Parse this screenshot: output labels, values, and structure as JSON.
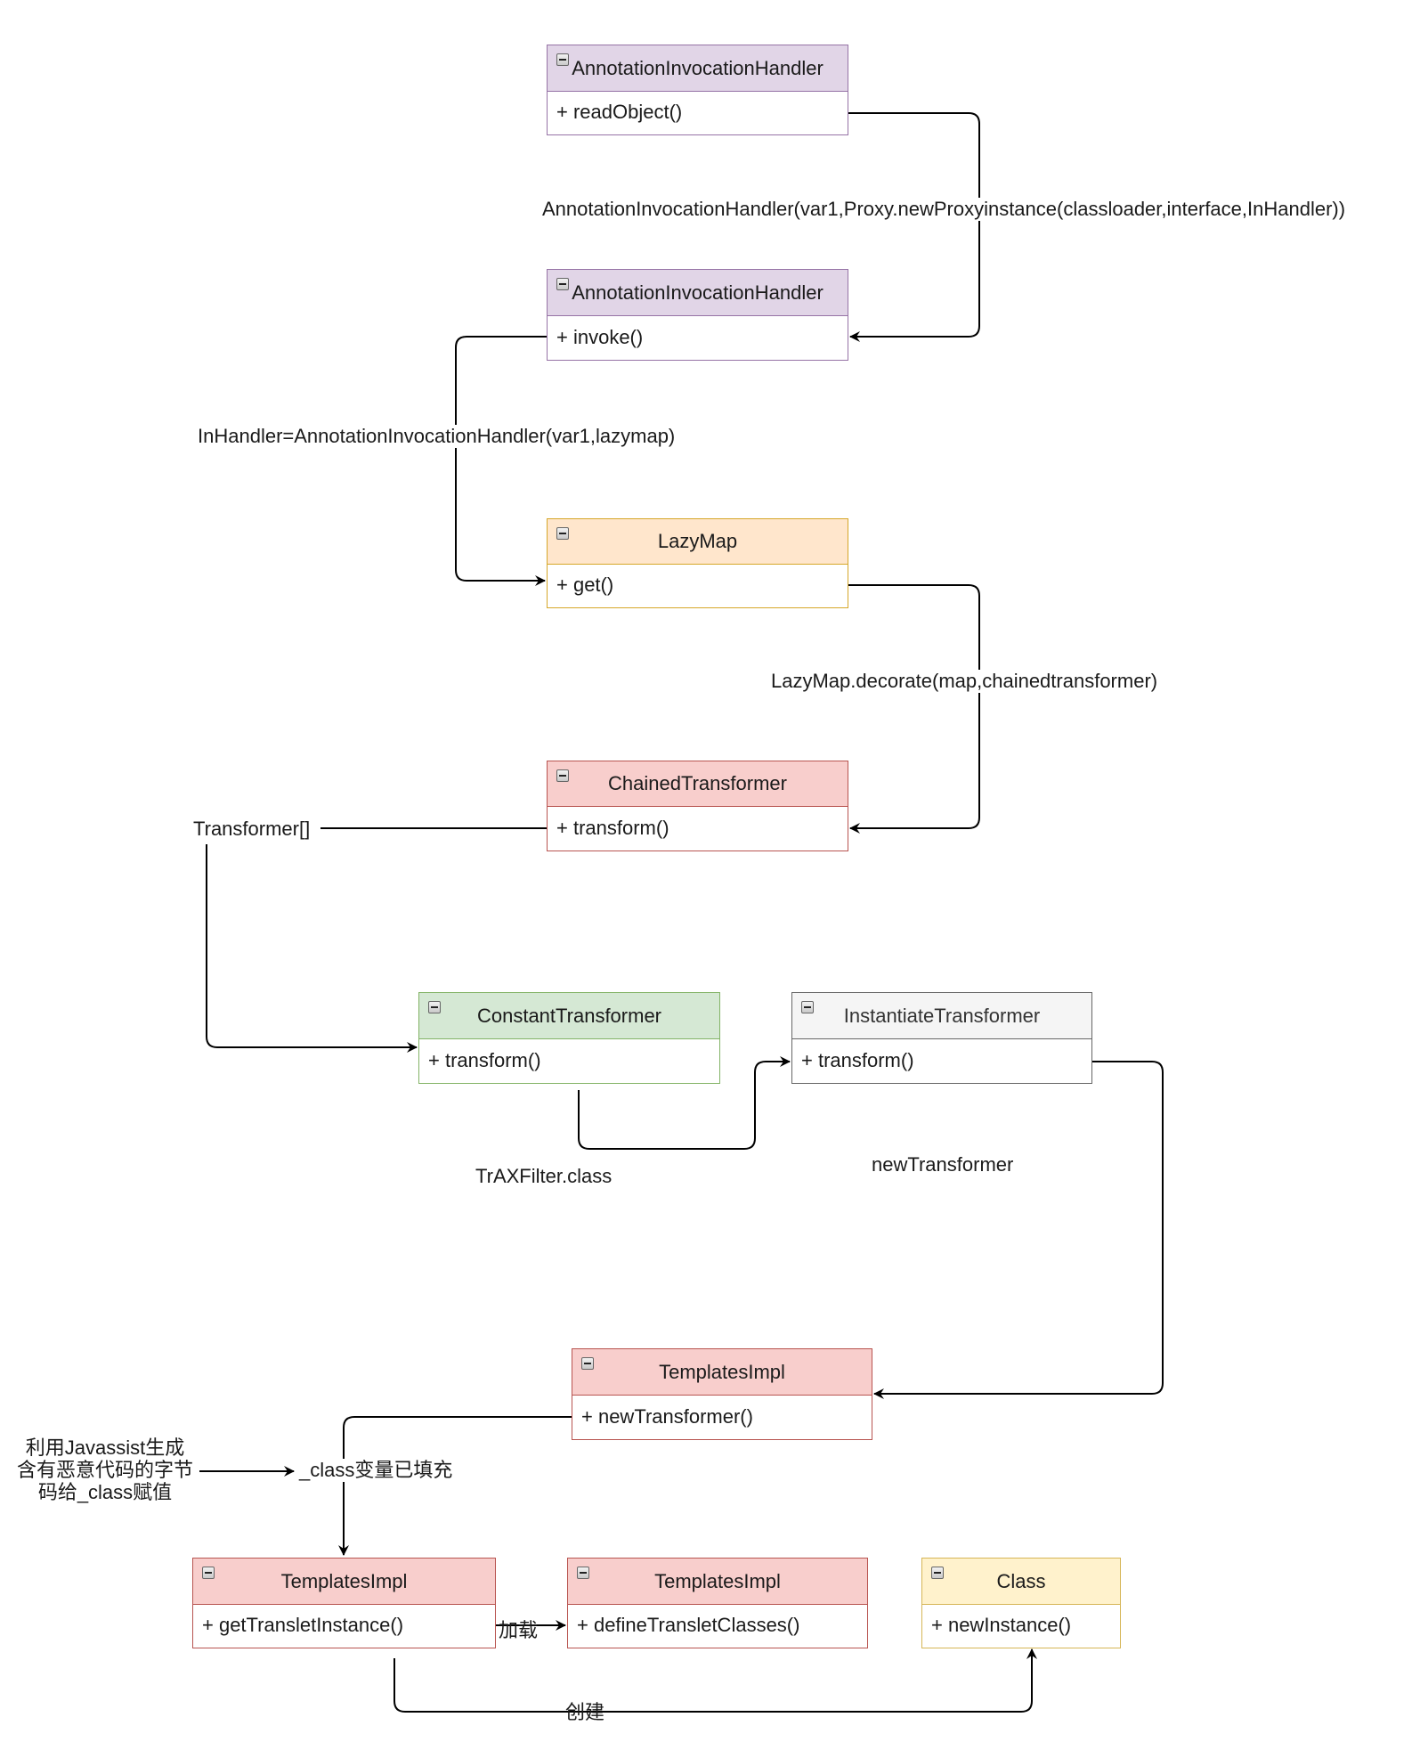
{
  "diagram": {
    "type": "uml-class-flow",
    "classes": [
      {
        "id": "aih-readobject",
        "name": "AnnotationInvocationHandler",
        "method": "+ readObject()",
        "fill": "#e1d5e7",
        "stroke": "#9673a6"
      },
      {
        "id": "aih-invoke",
        "name": "AnnotationInvocationHandler",
        "method": "+ invoke()",
        "fill": "#e1d5e7",
        "stroke": "#9673a6"
      },
      {
        "id": "lazymap",
        "name": "LazyMap",
        "method": "+ get()",
        "fill": "#ffe6cc",
        "stroke": "#d6a72a"
      },
      {
        "id": "chained",
        "name": "ChainedTransformer",
        "method": "+ transform()",
        "fill": "#f8cecc",
        "stroke": "#b85450"
      },
      {
        "id": "constant",
        "name": "ConstantTransformer",
        "method": "+ transform()",
        "fill": "#d5e8d4",
        "stroke": "#82b366"
      },
      {
        "id": "instantiate",
        "name": "InstantiateTransformer",
        "method": "+ transform()",
        "fill": "#f5f5f5",
        "stroke": "#666666"
      },
      {
        "id": "templates-newtransformer",
        "name": "TemplatesImpl",
        "method": "+ newTransformer()",
        "fill": "#f8cecc",
        "stroke": "#b85450"
      },
      {
        "id": "templates-gettranslet",
        "name": "TemplatesImpl",
        "method": "+ getTransletInstance()",
        "fill": "#f8cecc",
        "stroke": "#b85450"
      },
      {
        "id": "templates-define",
        "name": "TemplatesImpl",
        "method": "+ defineTransletClasses()",
        "fill": "#f8cecc",
        "stroke": "#b85450"
      },
      {
        "id": "class-newinstance",
        "name": "Class",
        "method": "+ newInstance()",
        "fill": "#fff2cc",
        "stroke": "#d6b656"
      }
    ],
    "edge_labels": {
      "proxy": "AnnotationInvocationHandler(var1,Proxy.newProxyinstance(classloader,interface,InHandler))",
      "inhandler": "InHandler=AnnotationInvocationHandler(var1,lazymap)",
      "decorate": "LazyMap.decorate(map,chainedtransformer)",
      "transformer_array": "Transformer[]",
      "trax": "TrAXFilter.class",
      "newtransformer": "newTransformer",
      "class_filled": "_class变量已填充",
      "javassist_note": "利用Javassist生成含有恶意代码的字节码给_class赋值",
      "load": "加载",
      "create": "创建"
    },
    "edges": [
      {
        "from": "aih-readobject",
        "to": "aih-invoke",
        "label": "proxy"
      },
      {
        "from": "aih-invoke",
        "to": "lazymap",
        "label": "inhandler"
      },
      {
        "from": "lazymap",
        "to": "chained",
        "label": "decorate"
      },
      {
        "from": "chained",
        "to": "constant",
        "label": "transformer_array"
      },
      {
        "from": "constant",
        "to": "instantiate",
        "label": "trax"
      },
      {
        "from": "instantiate",
        "to": "templates-newtransformer",
        "label": "newtransformer"
      },
      {
        "from": "templates-newtransformer",
        "to": "templates-gettranslet",
        "label": "class_filled"
      },
      {
        "from": "javassist_note",
        "to": "class_filled",
        "label": ""
      },
      {
        "from": "templates-gettranslet",
        "to": "templates-define",
        "label": "load"
      },
      {
        "from": "templates-gettranslet",
        "to": "class-newinstance",
        "label": "create"
      }
    ]
  }
}
